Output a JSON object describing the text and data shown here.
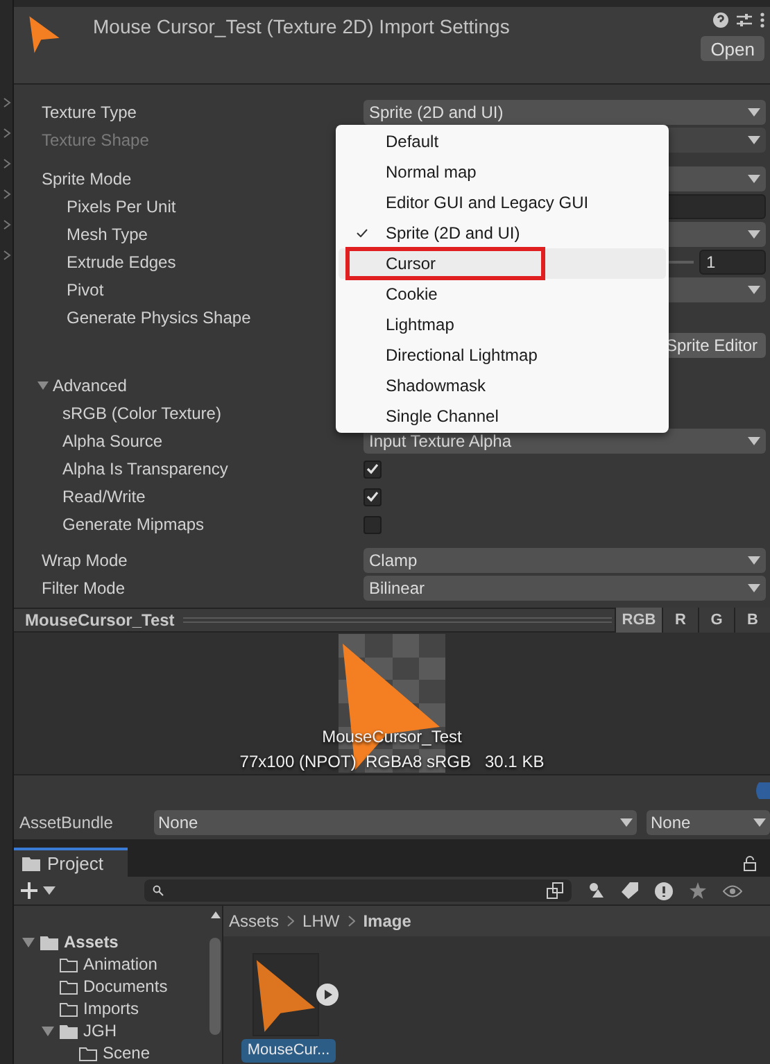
{
  "header": {
    "title": "Mouse Cursor_Test (Texture 2D) Import Settings",
    "button": "Open"
  },
  "properties": [
    {
      "kind": "dropdown",
      "label": "Texture Type",
      "value": "Sprite (2D and UI)"
    },
    {
      "kind": "dropdown",
      "label": "Texture Shape",
      "disabled": true
    },
    {
      "kind": "dropdown",
      "label": "Sprite Mode",
      "children": [
        {
          "kind": "field",
          "label": "Pixels Per Unit"
        },
        {
          "kind": "dropdown",
          "label": "Mesh Type"
        },
        {
          "kind": "slider",
          "label": "Extrude Edges",
          "value": "1"
        },
        {
          "kind": "dropdown",
          "label": "Pivot"
        },
        {
          "kind": "label",
          "label": "Generate Physics Shape"
        },
        {
          "kind": "button",
          "text": "Sprite Editor"
        }
      ]
    }
  ],
  "advanced": {
    "label": "Advanced",
    "expanded": true,
    "children": [
      {
        "kind": "label",
        "label": "sRGB (Color Texture)"
      },
      {
        "kind": "dropdown",
        "label": "Alpha Source",
        "value": "Input Texture Alpha"
      },
      {
        "kind": "checkbox",
        "label": "Alpha Is Transparency",
        "checked": true
      },
      {
        "kind": "checkbox",
        "label": "Read/Write",
        "checked": true
      },
      {
        "kind": "checkbox",
        "label": "Generate Mipmaps",
        "checked": false
      }
    ]
  },
  "wrap": [
    {
      "kind": "dropdown",
      "label": "Wrap Mode",
      "value": "Clamp"
    },
    {
      "kind": "dropdown",
      "label": "Filter Mode",
      "value": "Bilinear"
    }
  ],
  "menu": [
    {
      "label": "Default",
      "selected": false,
      "highlighted": false
    },
    {
      "label": "Normal map",
      "selected": false,
      "highlighted": false
    },
    {
      "label": "Editor GUI and Legacy GUI",
      "selected": false,
      "highlighted": false
    },
    {
      "label": "Sprite (2D and UI)",
      "selected": true,
      "highlighted": false
    },
    {
      "label": "Cursor",
      "selected": false,
      "highlighted": true
    },
    {
      "label": "Cookie",
      "selected": false,
      "highlighted": false
    },
    {
      "label": "Lightmap",
      "selected": false,
      "highlighted": false
    },
    {
      "label": "Directional Lightmap",
      "selected": false,
      "highlighted": false
    },
    {
      "label": "Shadowmask",
      "selected": false,
      "highlighted": false
    },
    {
      "label": "Single Channel",
      "selected": false,
      "highlighted": false
    }
  ],
  "preview": {
    "title": "MouseCursor_Test",
    "channels": [
      {
        "label": "RGB",
        "selected": true
      },
      {
        "label": "R",
        "selected": false
      },
      {
        "label": "G",
        "selected": false
      },
      {
        "label": "B",
        "selected": false
      }
    ],
    "name": "MouseCursor_Test",
    "info": "77x100 (NPOT)  RGBA8 sRGB   30.1 KB"
  },
  "asset_bundle": {
    "label": "AssetBundle",
    "values": [
      "None",
      "None"
    ]
  },
  "project": {
    "tab": "Project",
    "breadcrumb": [
      "Assets",
      "LHW",
      "Image"
    ],
    "tree": [
      {
        "label": "Assets",
        "expanded": true,
        "children": [
          {
            "label": "Animation"
          },
          {
            "label": "Documents"
          },
          {
            "label": "Imports"
          },
          {
            "label": "JGH",
            "expanded": true,
            "children": [
              {
                "label": "Scene"
              }
            ]
          }
        ]
      }
    ],
    "assets": [
      {
        "name": "MouseCur...",
        "selected": true
      }
    ]
  }
}
